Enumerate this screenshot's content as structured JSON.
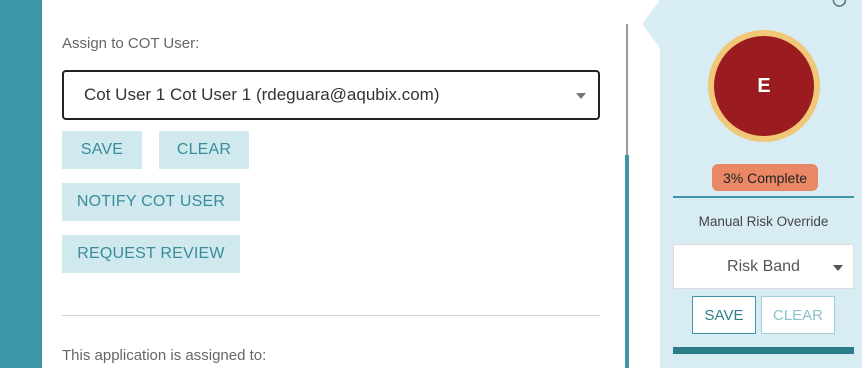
{
  "assign": {
    "label": "Assign to COT User:",
    "selected_user": "Cot User 1 Cot User 1 (rdeguara@aqubix.com)"
  },
  "actions": {
    "save": "SAVE",
    "clear": "CLEAR",
    "notify": "NOTIFY COT USER",
    "request_review": "REQUEST REVIEW"
  },
  "assigned_to_label": "This application is assigned to:",
  "sidebar": {
    "grade": "E",
    "progress_text": "3% Complete",
    "progress_value": 0.03,
    "override_label": "Manual Risk Override",
    "risk_band_placeholder": "Risk Band",
    "save": "SAVE",
    "clear": "CLEAR"
  },
  "colors": {
    "accent": "#3b97a5",
    "sidebar_bg": "#d7edf3",
    "grade_fill": "#9b1c20",
    "grade_ring": "#f1c878",
    "progress_badge": "#ea8866"
  },
  "icons": {
    "refresh": "refresh-icon",
    "dropdown": "chevron-down-icon"
  }
}
